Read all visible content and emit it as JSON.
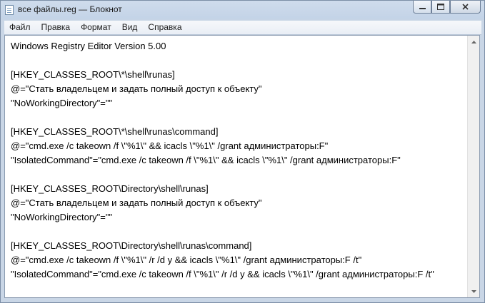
{
  "window": {
    "title": "все файлы.reg — Блокнот",
    "icon": "notepad-icon"
  },
  "menu": [
    {
      "label": "Файл"
    },
    {
      "label": "Правка"
    },
    {
      "label": "Формат"
    },
    {
      "label": "Вид"
    },
    {
      "label": "Справка"
    }
  ],
  "document": {
    "lines": [
      "Windows Registry Editor Version 5.00",
      "",
      "[HKEY_CLASSES_ROOT\\*\\shell\\runas]",
      "@=\"Стать владельцем и задать полный доступ к объекту\"",
      "\"NoWorkingDirectory\"=\"\"",
      "",
      "[HKEY_CLASSES_ROOT\\*\\shell\\runas\\command]",
      "@=\"cmd.exe /c takeown /f \\\"%1\\\" && icacls \\\"%1\\\" /grant администраторы:F\"",
      "\"IsolatedCommand\"=\"cmd.exe /c takeown /f \\\"%1\\\" && icacls \\\"%1\\\" /grant администраторы:F\"",
      "",
      "[HKEY_CLASSES_ROOT\\Directory\\shell\\runas]",
      "@=\"Стать владельцем и задать полный доступ к объекту\"",
      "\"NoWorkingDirectory\"=\"\"",
      "",
      "[HKEY_CLASSES_ROOT\\Directory\\shell\\runas\\command]",
      "@=\"cmd.exe /c takeown /f \\\"%1\\\" /r /d y && icacls \\\"%1\\\" /grant администраторы:F /t\"",
      "\"IsolatedCommand\"=\"cmd.exe /c takeown /f \\\"%1\\\" /r /d y && icacls \\\"%1\\\" /grant администраторы:F /t\""
    ]
  }
}
